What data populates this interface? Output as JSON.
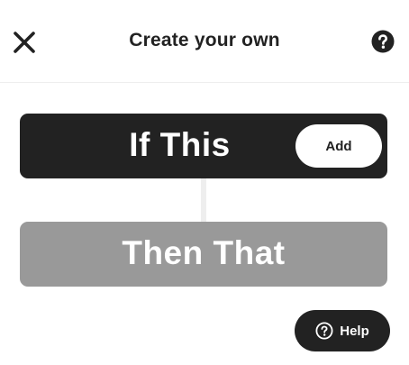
{
  "header": {
    "title": "Create your own",
    "close_icon": "close-icon",
    "help_icon": "question-circle-icon"
  },
  "applet": {
    "if_label": "If This",
    "add_label": "Add",
    "then_label": "Then That"
  },
  "help_button": {
    "label": "Help",
    "icon": "question-circle-outline-icon"
  },
  "colors": {
    "dark": "#222222",
    "disabled": "#999999",
    "connector": "#eeeeee",
    "background": "#ffffff"
  }
}
